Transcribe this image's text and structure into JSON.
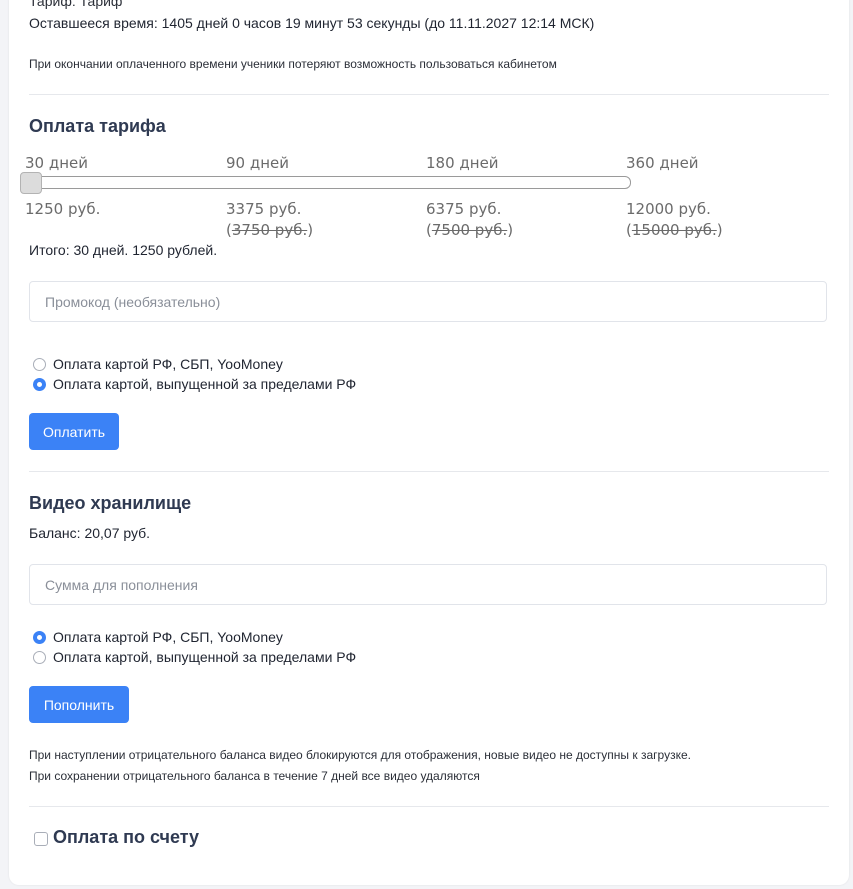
{
  "subscription": {
    "cut_line": "Тариф: Тариф",
    "remaining": "Оставшееся время: 1405 дней 0 часов 19 минут 53 секунды (до 11.11.2027 12:14 МСК)",
    "note": "При окончании оплаченного времени ученики потеряют возможность пользоваться кабинетом"
  },
  "tariff": {
    "title": "Оплата тарифа",
    "slider_value_index": 0,
    "tiers": [
      {
        "label": "30 дней",
        "price": "1250 руб.",
        "old_price": ""
      },
      {
        "label": "90 дней",
        "price": "3375 руб.",
        "old_price": "3750 руб."
      },
      {
        "label": "180 дней",
        "price": "6375 руб.",
        "old_price": "7500 руб."
      },
      {
        "label": "360 дней",
        "price": "12000 руб.",
        "old_price": "15000 руб."
      }
    ],
    "total": "Итого: 30 дней. 1250 рублей.",
    "promo_placeholder": "Промокод (необязательно)",
    "payment_options": [
      {
        "label": "Оплата картой РФ, СБП, YooMoney",
        "checked": false
      },
      {
        "label": "Оплата картой, выпущенной за пределами РФ",
        "checked": true
      }
    ],
    "pay_button": "Оплатить"
  },
  "video_storage": {
    "title": "Видео хранилище",
    "balance": "Баланс: 20,07 руб.",
    "amount_placeholder": "Сумма для пополнения",
    "payment_options": [
      {
        "label": "Оплата картой РФ, СБП, YooMoney",
        "checked": true
      },
      {
        "label": "Оплата картой, выпущенной за пределами РФ",
        "checked": false
      }
    ],
    "topup_button": "Пополнить",
    "note_1": "При наступлении отрицательного баланса видео блокируются для отображения, новые видео не доступны к загрузке.",
    "note_2": "При сохранении отрицательного баланса в течение 7 дней все видео удаляются"
  },
  "invoice": {
    "title": "Оплата по счету",
    "checked": false
  },
  "colors": {
    "accent": "#3b82f6",
    "heading": "#2f3a52"
  }
}
